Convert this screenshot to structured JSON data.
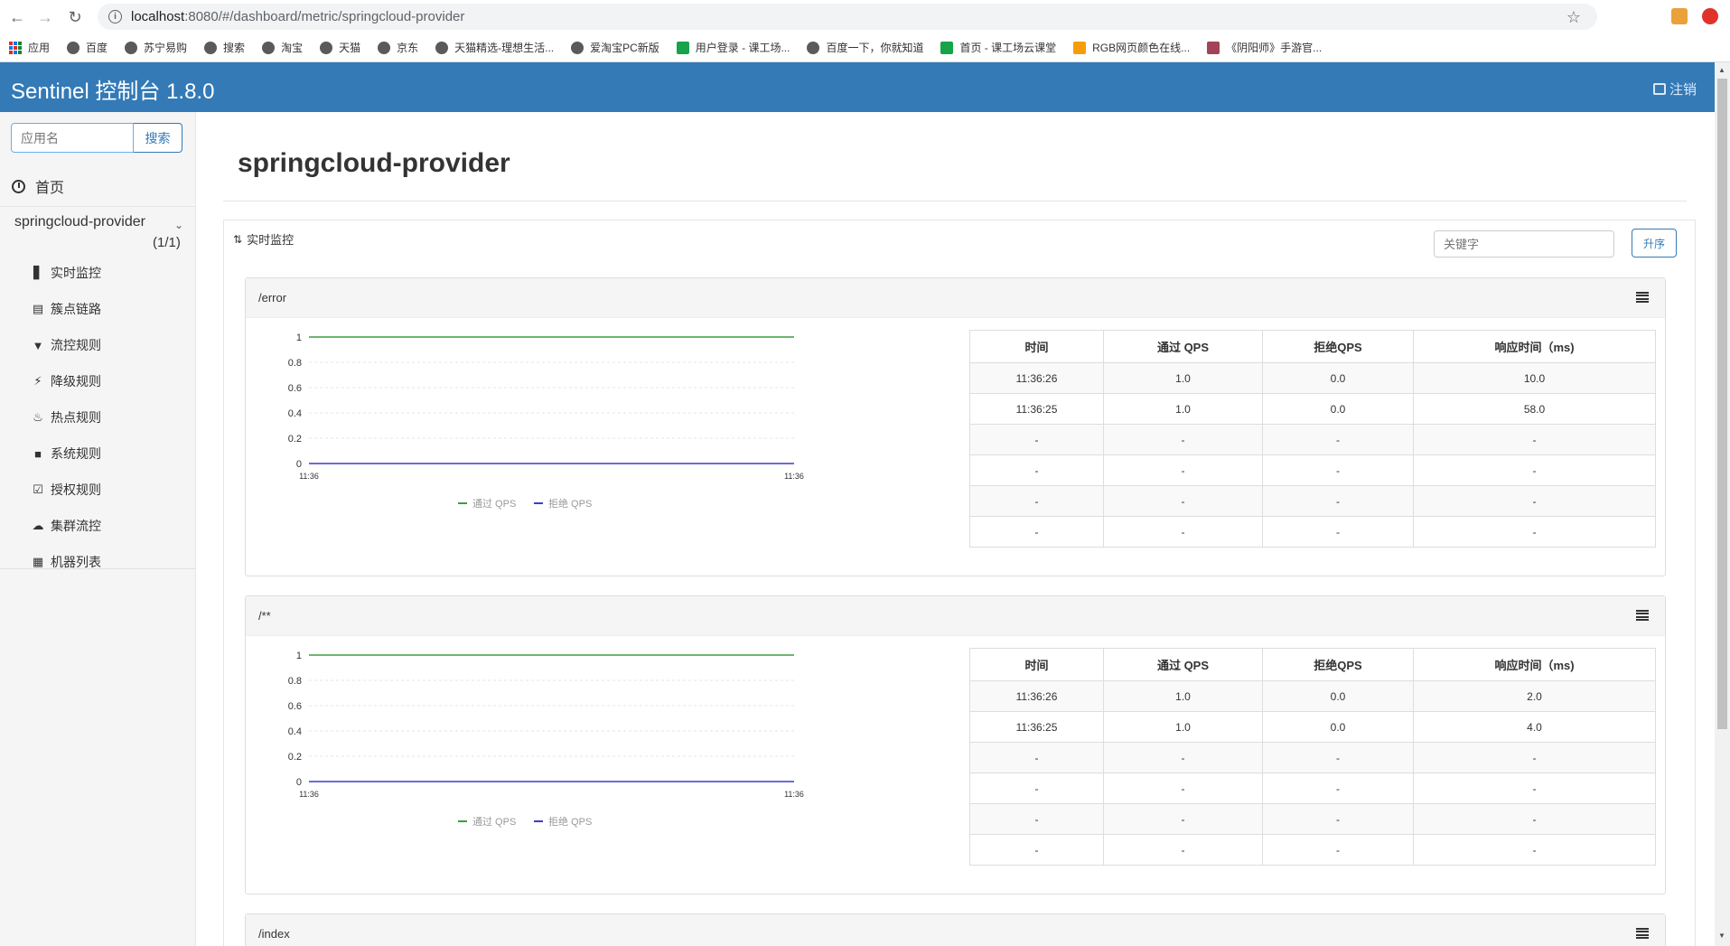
{
  "browser": {
    "url_host": "localhost",
    "url_path": ":8080/#/dashboard/metric/springcloud-provider",
    "bookmarks": [
      "应用",
      "百度",
      "苏宁易购",
      "搜索",
      "淘宝",
      "天猫",
      "京东",
      "天猫精选-理想生活...",
      "爱淘宝PC新版",
      "用户登录 - 课工场...",
      "百度一下，你就知道",
      "首页 - 课工场云课堂",
      "RGB网页颜色在线...",
      "《阴阳师》手游官..."
    ]
  },
  "header": {
    "title": "Sentinel 控制台 1.8.0",
    "logout": "注销",
    "bg_color": "#337ab7"
  },
  "sidebar": {
    "search_placeholder": "应用名",
    "search_button": "搜索",
    "home": "首页",
    "app_name": "springcloud-provider",
    "app_count": "(1/1)",
    "items": [
      {
        "label": "实时监控",
        "icon": "bar-chart-icon"
      },
      {
        "label": "簇点链路",
        "icon": "list-icon"
      },
      {
        "label": "流控规则",
        "icon": "filter-icon"
      },
      {
        "label": "降级规则",
        "icon": "bolt-icon"
      },
      {
        "label": "热点规则",
        "icon": "fire-icon"
      },
      {
        "label": "系统规则",
        "icon": "lock-icon"
      },
      {
        "label": "授权规则",
        "icon": "check-icon"
      },
      {
        "label": "集群流控",
        "icon": "cloud-icon"
      },
      {
        "label": "机器列表",
        "icon": "grid-icon"
      }
    ]
  },
  "main": {
    "page_title": "springcloud-provider",
    "section_label": "实时监控",
    "keyword_placeholder": "关键字",
    "sort_button": "升序",
    "table_headers": [
      "时间",
      "通过 QPS",
      "拒绝QPS",
      "响应时间（ms)"
    ],
    "resources": [
      {
        "name": "/error",
        "rows": [
          [
            "11:36:26",
            "1.0",
            "0.0",
            "10.0"
          ],
          [
            "11:36:25",
            "1.0",
            "0.0",
            "58.0"
          ],
          [
            "-",
            "-",
            "-",
            "-"
          ],
          [
            "-",
            "-",
            "-",
            "-"
          ],
          [
            "-",
            "-",
            "-",
            "-"
          ],
          [
            "-",
            "-",
            "-",
            "-"
          ]
        ]
      },
      {
        "name": "/**",
        "rows": [
          [
            "11:36:26",
            "1.0",
            "0.0",
            "2.0"
          ],
          [
            "11:36:25",
            "1.0",
            "0.0",
            "4.0"
          ],
          [
            "-",
            "-",
            "-",
            "-"
          ],
          [
            "-",
            "-",
            "-",
            "-"
          ],
          [
            "-",
            "-",
            "-",
            "-"
          ],
          [
            "-",
            "-",
            "-",
            "-"
          ]
        ]
      },
      {
        "name": "/index"
      }
    ]
  },
  "chart_data": [
    {
      "type": "line",
      "x": [
        "11:36",
        "11:36"
      ],
      "series": [
        {
          "name": "通过 QPS",
          "values": [
            1,
            1
          ],
          "color": "#3c9e3c"
        },
        {
          "name": "拒绝 QPS",
          "values": [
            0,
            0
          ],
          "color": "#3c3ccf"
        }
      ],
      "ylim": [
        0,
        1
      ],
      "yticks": [
        "0",
        "0.2",
        "0.4",
        "0.6",
        "0.8",
        "1"
      ],
      "xticks": [
        "11:36",
        "11:36"
      ],
      "grid": true,
      "legend": "bottom"
    },
    {
      "type": "line",
      "x": [
        "11:36",
        "11:36"
      ],
      "series": [
        {
          "name": "通过 QPS",
          "values": [
            1,
            1
          ],
          "color": "#3c9e3c"
        },
        {
          "name": "拒绝 QPS",
          "values": [
            0,
            0
          ],
          "color": "#3c3ccf"
        }
      ],
      "ylim": [
        0,
        1
      ],
      "yticks": [
        "0",
        "0.2",
        "0.4",
        "0.6",
        "0.8",
        "1"
      ],
      "xticks": [
        "11:36",
        "11:36"
      ],
      "grid": true,
      "legend": "bottom"
    }
  ]
}
